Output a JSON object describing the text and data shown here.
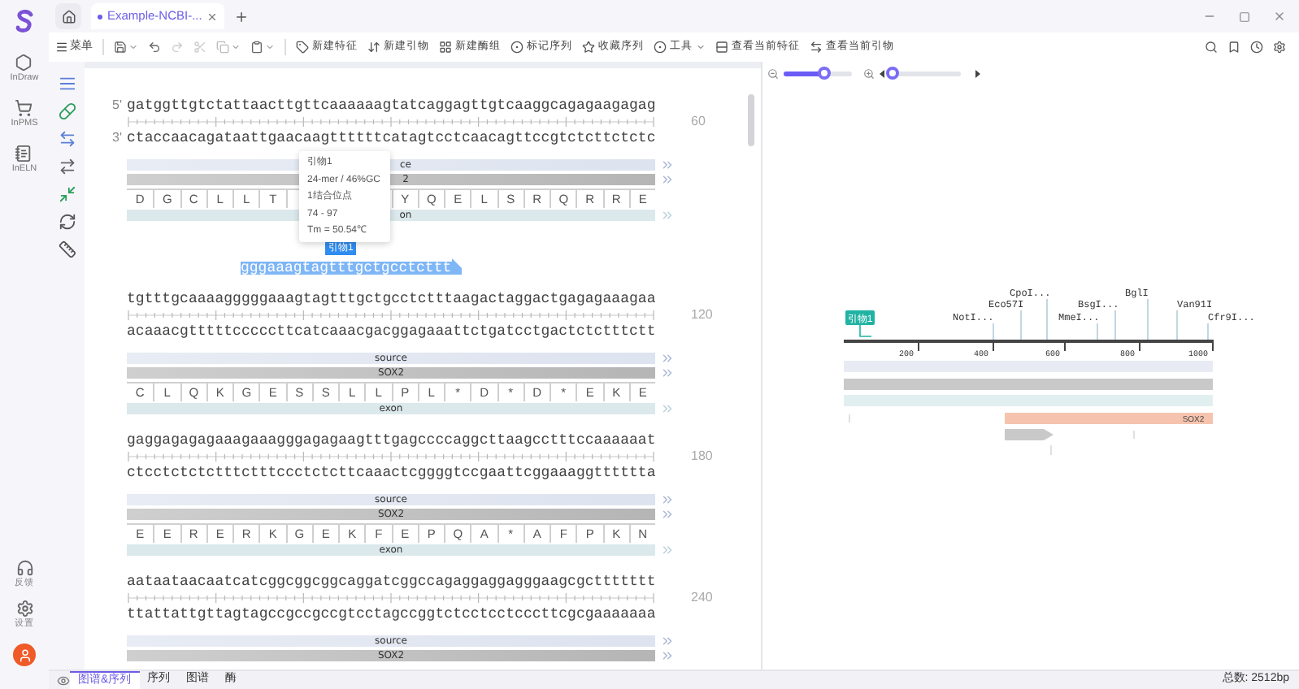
{
  "nav": {
    "items": [
      {
        "label": "InDraw"
      },
      {
        "label": "InPMS"
      },
      {
        "label": "InELN"
      }
    ],
    "bottom": [
      {
        "label": "反馈"
      },
      {
        "label": "设置"
      }
    ]
  },
  "tabs": [
    {
      "label": "Example-NCBI-...",
      "modified": true,
      "selected": true
    }
  ],
  "toolbar": {
    "menu": "菜单",
    "actions": [
      {
        "label": "新建特征",
        "dropdown": false
      },
      {
        "label": "新建引物",
        "dropdown": false
      },
      {
        "label": "新建酶组",
        "dropdown": false
      },
      {
        "label": "标记序列",
        "dropdown": false
      },
      {
        "label": "收藏序列",
        "dropdown": false
      },
      {
        "label": "工具",
        "dropdown": true
      },
      {
        "label": "查看当前特征",
        "dropdown": false
      },
      {
        "label": "查看当前引物",
        "dropdown": false
      }
    ]
  },
  "zoom": {
    "level": 0.6
  },
  "position": {
    "level": 0.05
  },
  "sequence": {
    "blocks": [
      {
        "forward": "gatggttgtctattaacttgttcaaaaaagtatcaggagttgtcaaggcagagaagagag",
        "reverse": "ctaccaacagataattgaacaagttttttcatagtcctcaacagttccgtctcttctctc",
        "strand_marks": [
          "5'",
          "3'"
        ],
        "number": "60",
        "features": [
          {
            "kind": "source",
            "label": "ce"
          },
          {
            "kind": "gene",
            "label": "2"
          }
        ],
        "translation": [
          [
            "D",
            "G",
            "C",
            "L",
            "L",
            "T"
          ],
          [
            "Y",
            "Q",
            "E",
            "L",
            "S",
            "R",
            "Q",
            "R",
            "R",
            "E"
          ]
        ],
        "exon": {
          "label": "on"
        }
      },
      {
        "forward": "tgtttgcaaaagggggaaagtagtttgctgcctctttaagactaggactgagagaaagaa",
        "reverse": "acaaacgtttttcccccttcatcaaacgacggagaaattctgatcctgactctctttctt",
        "number": "120",
        "features": [
          {
            "kind": "source",
            "label": "source"
          },
          {
            "kind": "gene",
            "label": "SOX2"
          }
        ],
        "translation": [
          [
            "C",
            "L",
            "Q",
            "K",
            "G",
            "E",
            "S",
            "S",
            "L",
            "L",
            "P",
            "L",
            "*",
            "D",
            "*",
            "D",
            "*",
            "E",
            "K",
            "E"
          ]
        ],
        "exon": {
          "label": "exon"
        }
      },
      {
        "forward": "gaggagagagaaagaaagggagagaagtttgagccccaggcttaagcctttccaaaaaat",
        "reverse": "ctcctctctctttctttccctctcttcaaactcggggtccgaattcggaaaggtttttta",
        "number": "180",
        "features": [
          {
            "kind": "source",
            "label": "source"
          },
          {
            "kind": "gene",
            "label": "SOX2"
          }
        ],
        "translation": [
          [
            "E",
            "E",
            "R",
            "E",
            "R",
            "K",
            "G",
            "E",
            "K",
            "F",
            "E",
            "P",
            "Q",
            "A",
            "*",
            "A",
            "F",
            "P",
            "K",
            "N"
          ]
        ],
        "exon": {
          "label": "exon"
        }
      },
      {
        "forward": "aataataacaatcatcggcggcggcaggatcggccagaggaggagggaagcgcttttttt",
        "reverse": "ttattattgttagtagccgccgccgtcctagccggtctcctcctcccttcgcgaaaaaaa",
        "number": "240",
        "features": [
          {
            "kind": "source",
            "label": "source"
          },
          {
            "kind": "gene",
            "label": "SOX2"
          }
        ]
      }
    ]
  },
  "primer": {
    "label": "引物1",
    "sequence": "gggaaagtagtttgctgcctcttt"
  },
  "tooltip": {
    "lines": [
      "引物1",
      "24-mer / 46%GC",
      "1结合位点",
      "74 - 97",
      "Tm = 50.54℃"
    ]
  },
  "map": {
    "primer_label": "引物1",
    "enzymes": [
      {
        "name": "NotI..."
      },
      {
        "name": "Eco57I"
      },
      {
        "name": "CpoI..."
      },
      {
        "name": "MmeI..."
      },
      {
        "name": "BsgI..."
      },
      {
        "name": "BglI"
      },
      {
        "name": "Van91I"
      },
      {
        "name": "Cfr9I..."
      }
    ],
    "ticks": [
      "200",
      "400",
      "600",
      "800",
      "1000"
    ],
    "features": [
      {
        "kind": "source"
      },
      {
        "kind": "gene"
      },
      {
        "kind": "exon"
      },
      {
        "kind": "cds",
        "label": "SOX2"
      },
      {
        "kind": "primer"
      }
    ]
  },
  "bottom_tabs": [
    {
      "label": "图谱&序列",
      "selected": true
    },
    {
      "label": "序列",
      "selected": false
    },
    {
      "label": "图谱",
      "selected": false
    },
    {
      "label": "酶",
      "selected": false
    }
  ],
  "status": "总数: 2512bp"
}
